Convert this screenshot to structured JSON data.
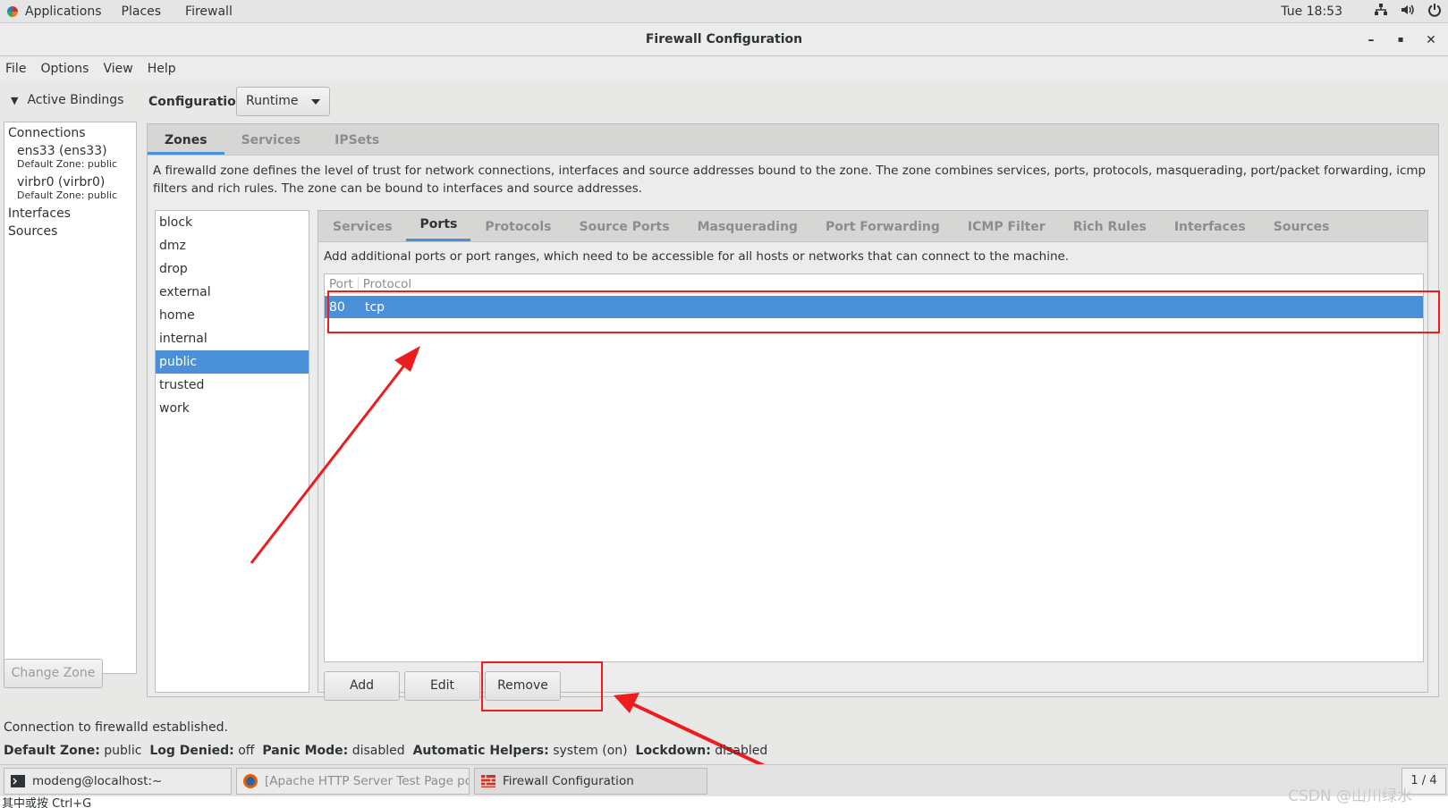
{
  "top_panel": {
    "menu": [
      "Applications",
      "Places",
      "Firewall"
    ],
    "clock": "Tue 18:53",
    "icons": [
      "network-icon",
      "volume-icon",
      "power-icon"
    ]
  },
  "window": {
    "title": "Firewall Configuration",
    "minimize": "–",
    "maximize": "▪",
    "close": "✕"
  },
  "menubar": [
    "File",
    "Options",
    "View",
    "Help"
  ],
  "left": {
    "active_bindings": "Active Bindings",
    "connections_header": "Connections",
    "connections": [
      {
        "name": "ens33 (ens33)",
        "zone": "Default Zone: public"
      },
      {
        "name": "virbr0 (virbr0)",
        "zone": "Default Zone: public"
      }
    ],
    "interfaces": "Interfaces",
    "sources": "Sources",
    "change_zone": "Change Zone"
  },
  "config": {
    "label": "Configuration:",
    "value": "Runtime"
  },
  "main_tabs": [
    "Zones",
    "Services",
    "IPSets"
  ],
  "zone_description": "A firewalld zone defines the level of trust for network connections, interfaces and source addresses bound to the zone. The zone combines services, ports, protocols, masquerading, port/packet forwarding, icmp filters and rich rules. The zone can be bound to interfaces and source addresses.",
  "zones": [
    "block",
    "dmz",
    "drop",
    "external",
    "home",
    "internal",
    "public",
    "trusted",
    "work"
  ],
  "selected_zone": "public",
  "zone_tabs": [
    "Services",
    "Ports",
    "Protocols",
    "Source Ports",
    "Masquerading",
    "Port Forwarding",
    "ICMP Filter",
    "Rich Rules",
    "Interfaces",
    "Sources"
  ],
  "ports": {
    "description": "Add additional ports or port ranges, which need to be accessible for all hosts or networks that can connect to the machine.",
    "columns": [
      "Port",
      "Protocol"
    ],
    "rows": [
      {
        "port": "80",
        "protocol": "tcp"
      }
    ],
    "buttons": {
      "add": "Add",
      "edit": "Edit",
      "remove": "Remove"
    }
  },
  "status": {
    "connection": "Connection to firewalld established.",
    "default_zone_label": "Default Zone:",
    "default_zone": "public",
    "log_denied_label": "Log Denied:",
    "log_denied": "off",
    "panic_mode_label": "Panic Mode:",
    "panic_mode": "disabled",
    "helpers_label": "Automatic Helpers:",
    "helpers": "system (on)",
    "lockdown_label": "Lockdown:",
    "lockdown": "disabled"
  },
  "taskbar": {
    "tasks": [
      "modeng@localhost:~",
      "[Apache HTTP Server Test Page po...",
      "Firewall Configuration"
    ],
    "pager": "1 / 4"
  },
  "bottom_hint": "其中或按 Ctrl+G",
  "watermark": "CSDN @山川绿水",
  "annotation_color": "#ee1c1c",
  "accent_color": "#4a90d9"
}
